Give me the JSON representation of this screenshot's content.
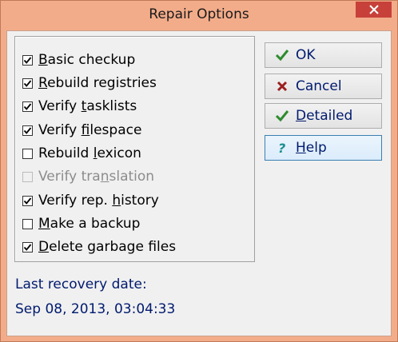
{
  "window": {
    "title": "Repair Options"
  },
  "options": [
    {
      "pre": "",
      "u": "B",
      "post": "asic checkup",
      "checked": true,
      "enabled": true
    },
    {
      "pre": "",
      "u": "R",
      "post": "ebuild registries",
      "checked": true,
      "enabled": true
    },
    {
      "pre": "Verify ",
      "u": "t",
      "post": "asklists",
      "checked": true,
      "enabled": true
    },
    {
      "pre": "Verify ",
      "u": "f",
      "post": "ilespace",
      "checked": true,
      "enabled": true
    },
    {
      "pre": "Rebuild ",
      "u": "l",
      "post": "exicon",
      "checked": false,
      "enabled": true
    },
    {
      "pre": "Verify tra",
      "u": "n",
      "post": "slation",
      "checked": false,
      "enabled": false
    },
    {
      "pre": "Verify rep. ",
      "u": "h",
      "post": "istory",
      "checked": true,
      "enabled": true
    },
    {
      "pre": "",
      "u": "M",
      "post": "ake a backup",
      "checked": false,
      "enabled": true
    },
    {
      "pre": "",
      "u": "D",
      "post": "elete garbage files",
      "checked": true,
      "enabled": true
    }
  ],
  "buttons": {
    "ok": {
      "label": "OK",
      "icon": "checkmark-icon",
      "color": "#2e8b2e"
    },
    "cancel": {
      "label": "Cancel",
      "icon": "x-icon",
      "color": "#9c1f1f"
    },
    "detailed": {
      "pre": "",
      "u": "D",
      "post": "etailed",
      "icon": "checkmark-icon",
      "color": "#2e8b2e"
    },
    "help": {
      "pre": "",
      "u": "H",
      "post": "elp",
      "icon": "question-icon",
      "color": "#1a8f8f"
    }
  },
  "recovery": {
    "label": "Last recovery date:",
    "value": "Sep 08, 2013, 03:04:33"
  }
}
